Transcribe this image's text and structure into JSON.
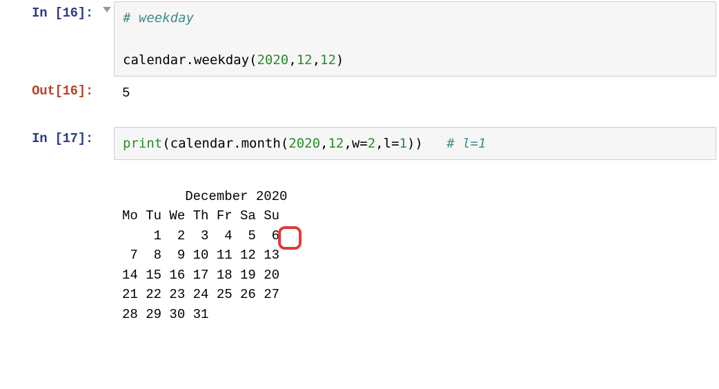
{
  "cells": {
    "c16": {
      "in_prompt": "In [16]:",
      "out_prompt": "Out[16]:",
      "comment_line": "# weekday",
      "code_plain_pre": "calendar.weekday(",
      "num1": "2020",
      "comma1": ",",
      "num2": "12",
      "comma2": ",",
      "num3": "12",
      "code_plain_post": ")",
      "output": "5"
    },
    "c17": {
      "in_prompt": "In [17]:",
      "func": "print",
      "open_paren": "(",
      "inner_call_pre": "calendar.month(",
      "n1": "2020",
      "cm1": ",",
      "n2": "12",
      "cm2": ",",
      "kw1": "w",
      "eq1": "=",
      "v1": "2",
      "cm3": ",",
      "kw2": "l",
      "eq2": "=",
      "v2": "1",
      "inner_call_post": "))",
      "gap": "   ",
      "comment": "# l=1",
      "output": "    December 2020\nMo Tu We Th Fr Sa Su\n    1  2  3  4  5  6\n 7  8  9 10 11 12 13\n14 15 16 17 18 19 20\n21 22 23 24 25 26 27\n28 29 30 31\n"
    }
  },
  "highlight": {
    "value": "12"
  }
}
